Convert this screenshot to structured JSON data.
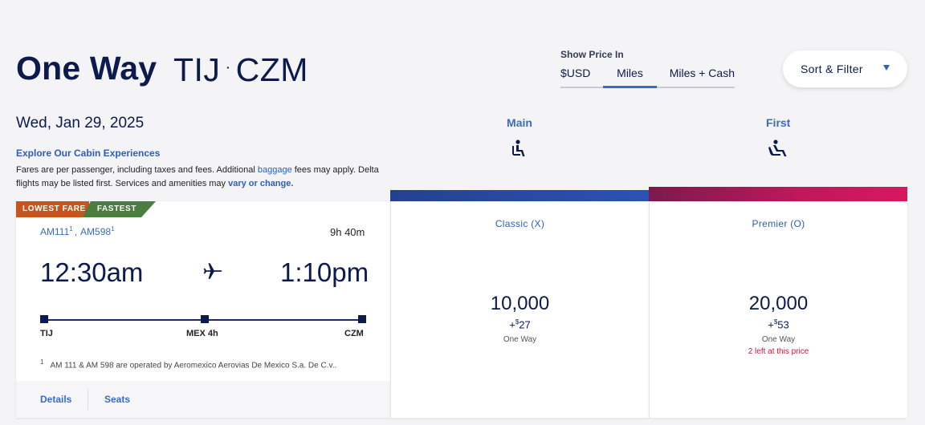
{
  "header": {
    "trip_type": "One Way",
    "origin": "TIJ",
    "destination": "CZM",
    "route_separator": "·"
  },
  "price_toggle": {
    "label": "Show Price In",
    "options": [
      "$USD",
      "Miles",
      "Miles + Cash"
    ],
    "selected": "Miles"
  },
  "sort_filter": {
    "label": "Sort & Filter",
    "icon": "caret-down-icon"
  },
  "info": {
    "date": "Wed, Jan 29, 2025",
    "explore_link": "Explore Our Cabin Experiences",
    "fares_text_1": "Fares are per passenger, including taxes and fees. Additional ",
    "baggage_link": "baggage",
    "fares_text_2": " fees may apply. Delta flights may be listed first. Services and amenities may ",
    "vary_link": "vary or change."
  },
  "cabins": [
    {
      "label": "Main",
      "icon": "seat-icon"
    },
    {
      "label": "First",
      "icon": "recliner-seat-icon"
    }
  ],
  "flight": {
    "tags": [
      "LOWEST FARE",
      "FASTEST"
    ],
    "flight_1": "AM111",
    "flight_2": "AM598",
    "footnote_marker": "1",
    "separator": ",",
    "duration": "9h 40m",
    "depart_time": "12:30am",
    "arrive_time": "1:10pm",
    "origin": "TIJ",
    "layover": "MEX 4h",
    "destination": "CZM",
    "footnote": "AM 111 & AM 598 are operated by Aeromexico Aerovias De Mexico S.a. De C.v..",
    "details_link": "Details",
    "seats_link": "Seats"
  },
  "fares": [
    {
      "name": "Classic (X)",
      "miles": "10,000",
      "cash_prefix": "+",
      "currency": "$",
      "cash": "27",
      "way": "One Way",
      "availability": ""
    },
    {
      "name": "Premier (O)",
      "miles": "20,000",
      "cash_prefix": "+",
      "currency": "$",
      "cash": "53",
      "way": "One Way",
      "availability": "2 left at this price"
    }
  ],
  "colors": {
    "brand_navy": "#0c1a4e",
    "link_blue": "#2d5dc0",
    "lowest_fare_tag": "#c5551b",
    "fastest_tag": "#4a7d3e",
    "main_bar": "#2b53b3",
    "first_bar": "#c2175b",
    "availability_red": "#c01c3b"
  }
}
